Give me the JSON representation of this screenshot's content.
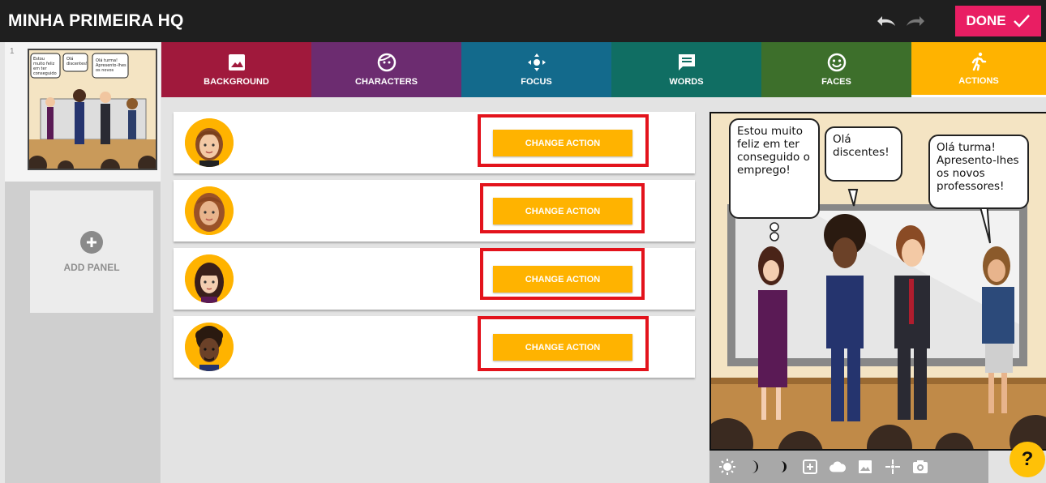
{
  "app": {
    "title": "MINHA PRIMEIRA HQ",
    "done_label": "DONE"
  },
  "sidebar": {
    "panel_number": "1",
    "add_panel_label": "ADD PANEL",
    "thumb_bubbles": [
      "Estou muito feliz em ter conseguido o emprego!",
      "Olá discentes!",
      "Olá turma! Apresento-lhes os novos professores!"
    ]
  },
  "tabs": [
    {
      "label": "BACKGROUND",
      "icon": "image-icon"
    },
    {
      "label": "CHARACTERS",
      "icon": "face-outline-icon"
    },
    {
      "label": "FOCUS",
      "icon": "move-arrows-icon"
    },
    {
      "label": "WORDS",
      "icon": "speech-bubble-icon"
    },
    {
      "label": "FACES",
      "icon": "smiley-icon"
    },
    {
      "label": "ACTIONS",
      "icon": "running-person-icon"
    }
  ],
  "characters": [
    {
      "button_label": "CHANGE ACTION",
      "avatar": "woman-brown-hair"
    },
    {
      "button_label": "CHANGE ACTION",
      "avatar": "woman-long-brown-hair"
    },
    {
      "button_label": "CHANGE ACTION",
      "avatar": "woman-dark-hair"
    },
    {
      "button_label": "CHANGE ACTION",
      "avatar": "man-curly-hair"
    }
  ],
  "preview": {
    "bubble_1": "Estou muito feliz em ter conseguido o emprego!",
    "bubble_2": "Olá discentes!",
    "bubble_3": "Olá turma! Apresento-lhes os novos professores!"
  },
  "toolbar": [
    "brightness-icon",
    "moon-icon",
    "half-moon-icon",
    "add-frame-icon",
    "cloud-icon",
    "image-icon",
    "sparkle-icon",
    "camera-icon"
  ],
  "help_label": "?",
  "colors": {
    "actions_accent": "#ffb300",
    "done": "#e91e63",
    "highlight": "#e3131c"
  }
}
